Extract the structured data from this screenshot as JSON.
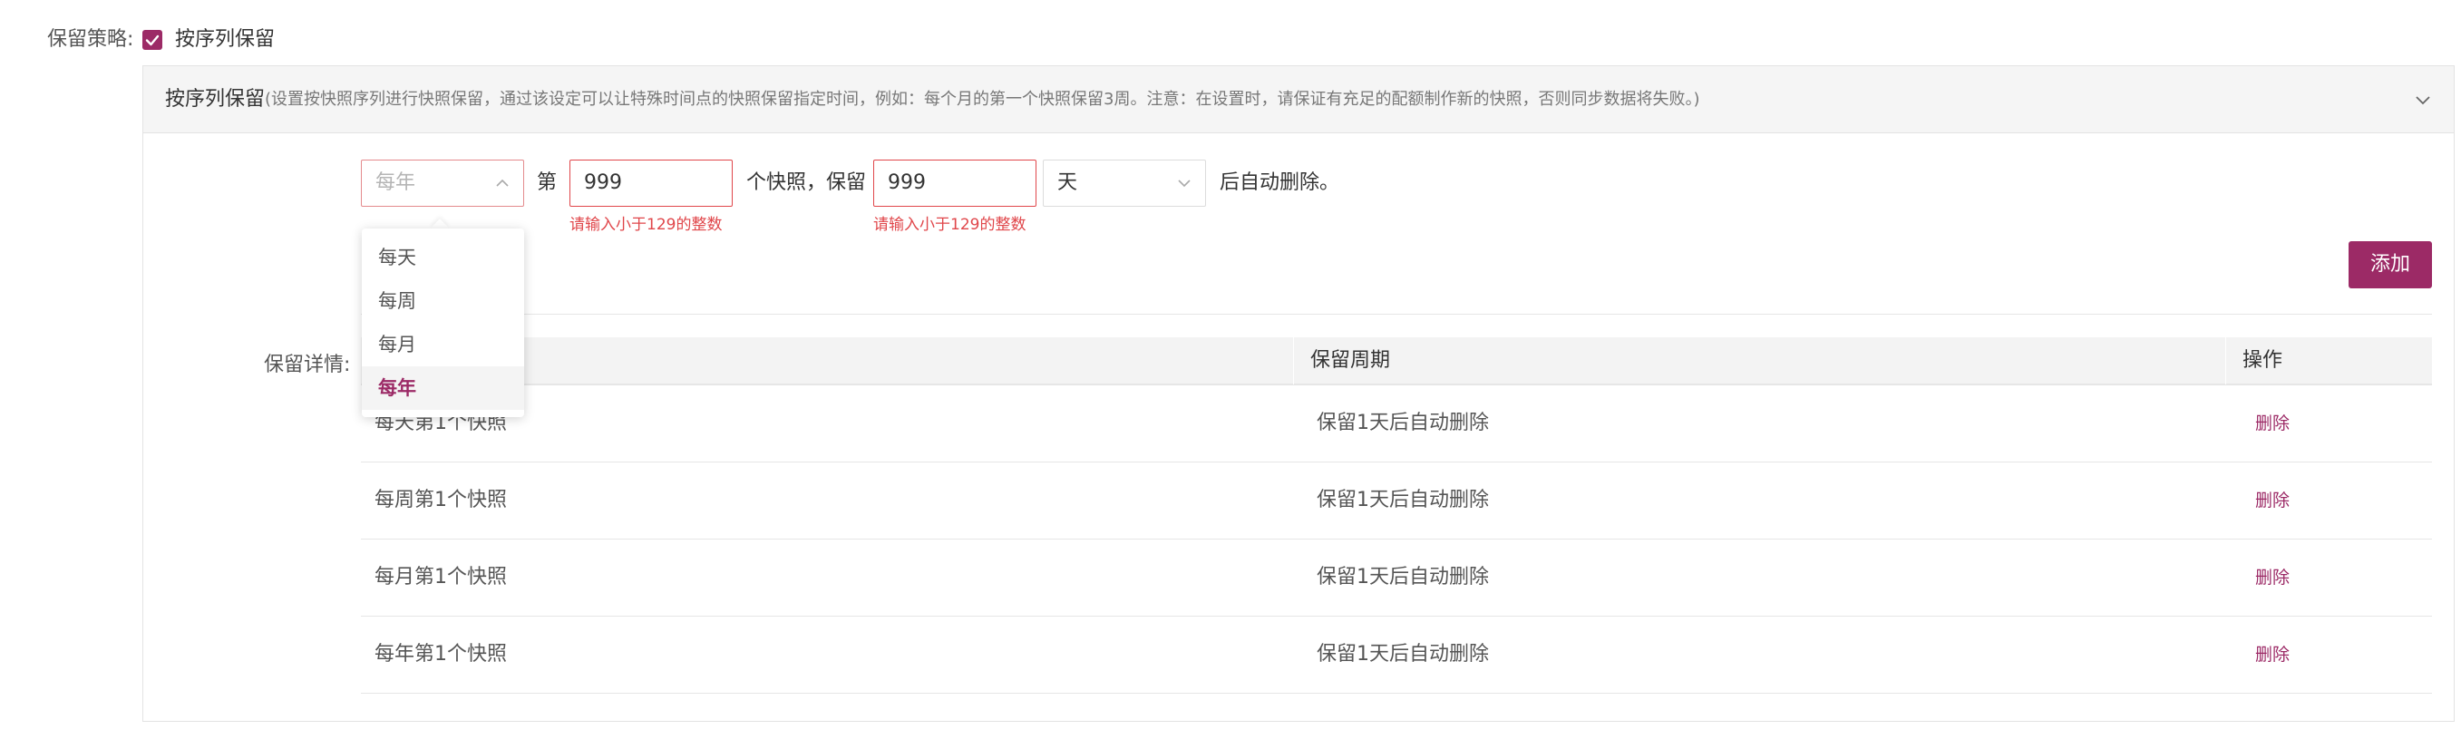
{
  "strategy": {
    "label": "保留策略:",
    "checkbox_label": "按序列保留",
    "checked": true
  },
  "panel": {
    "title": "按序列保留",
    "description": "(设置按快照序列进行快照保留，通过该设定可以让特殊时间点的快照保留指定时间，例如：每个月的第一个快照保留3周。注意：在设置时，请保证有充足的配额制作新的快照，否则同步数据将失败。)"
  },
  "rule_form": {
    "period_placeholder": "每年",
    "di_label": "第",
    "count_value": "999",
    "mid_label": "个快照，保留",
    "keep_value": "999",
    "unit_value": "天",
    "after_label": "后自动删除。",
    "count_error": "请输入小于129的整数",
    "keep_error": "请输入小于129的整数",
    "add_label": "添加"
  },
  "dropdown": {
    "options": [
      "每天",
      "每周",
      "每月",
      "每年"
    ],
    "selected_index": 3
  },
  "details": {
    "label": "保留详情:",
    "columns": [
      "保留周期",
      "操作"
    ],
    "rows": [
      {
        "snapshot": "每天第1个快照",
        "period": "保留1天后自动删除",
        "action": "删除"
      },
      {
        "snapshot": "每周第1个快照",
        "period": "保留1天后自动删除",
        "action": "删除"
      },
      {
        "snapshot": "每月第1个快照",
        "period": "保留1天后自动删除",
        "action": "删除"
      },
      {
        "snapshot": "每年第1个快照",
        "period": "保留1天后自动删除",
        "action": "删除"
      }
    ]
  },
  "colors": {
    "accent": "#9c2a66",
    "error": "#e0464a"
  }
}
